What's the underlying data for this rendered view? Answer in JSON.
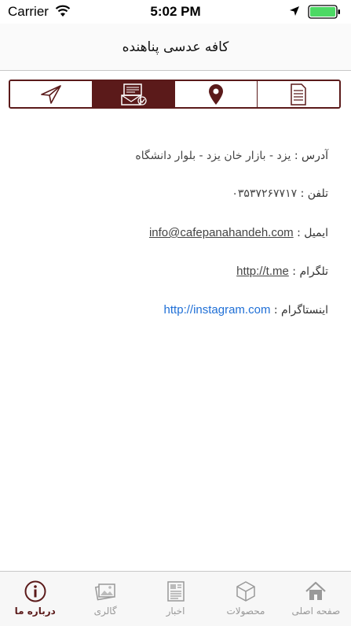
{
  "status_bar": {
    "carrier": "Carrier",
    "time": "5:02 PM"
  },
  "nav": {
    "title": "کافه عدسی پناهنده"
  },
  "segments": [
    {
      "icon": "send-icon",
      "active": false
    },
    {
      "icon": "laptop-mail-icon",
      "active": true
    },
    {
      "icon": "location-pin-icon",
      "active": false
    },
    {
      "icon": "document-icon",
      "active": false
    }
  ],
  "info": {
    "address_label": "آدرس :",
    "address_value": "یزد - بازار خان یزد - بلوار دانشگاه",
    "phone_label": "تلفن :",
    "phone_value": "۰۳۵۳۷۲۶۷۷۱۷",
    "email_label": "ایمیل :",
    "email_value": "info@cafepanahandeh.com",
    "telegram_label": "تلگرام :",
    "telegram_value": "http://t.me",
    "instagram_label": "اینستاگرام :",
    "instagram_value": "http://instagram.com"
  },
  "tabs": [
    {
      "label": "درباره ما",
      "icon": "info-icon",
      "active": true
    },
    {
      "label": "گالری",
      "icon": "gallery-icon",
      "active": false
    },
    {
      "label": "اخبار",
      "icon": "news-icon",
      "active": false
    },
    {
      "label": "محصولات",
      "icon": "box-icon",
      "active": false
    },
    {
      "label": "صفحه اصلی",
      "icon": "home-icon",
      "active": false
    }
  ],
  "colors": {
    "accent": "#5b1a1a",
    "link": "#1f6fd6",
    "battery": "#4cd964"
  }
}
